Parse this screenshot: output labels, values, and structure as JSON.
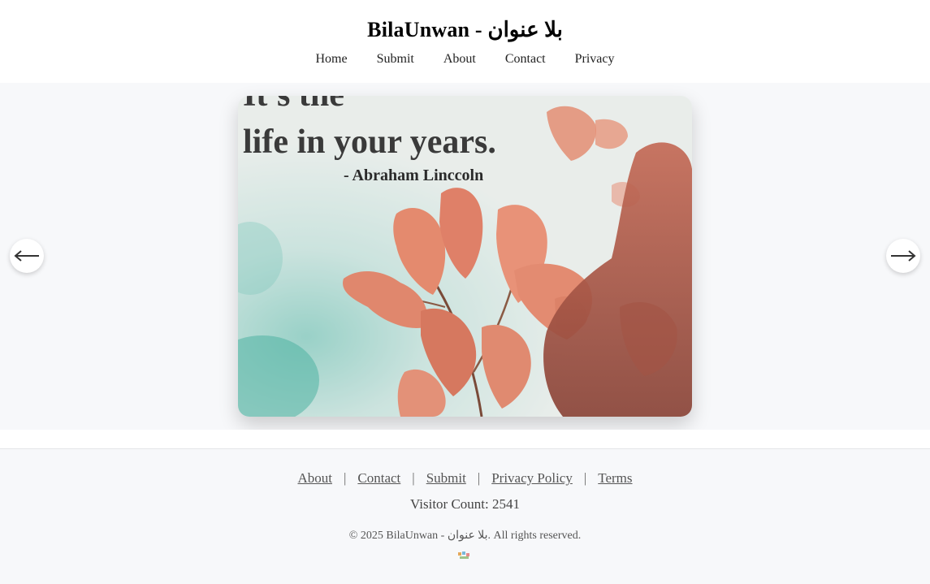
{
  "header": {
    "title": "BilaUnwan - بلا عنوان"
  },
  "nav": {
    "items": [
      "Home",
      "Submit",
      "About",
      "Contact",
      "Privacy"
    ]
  },
  "carousel": {
    "slide": {
      "quote_line_partial": "It's the",
      "quote_line": "life in your years.",
      "attribution": "- Abraham Linccoln"
    },
    "prev_icon": "arrow-left-icon",
    "next_icon": "arrow-right-icon"
  },
  "footer": {
    "links": [
      "About",
      "Contact",
      "Submit",
      "Privacy Policy",
      "Terms"
    ],
    "separator": "|",
    "visitor_count": "Visitor Count: 2541",
    "copyright": "© 2025 BilaUnwan - بلا عنوان. All rights reserved."
  },
  "colors": {
    "page_background": "#f7f8fa",
    "header_background": "#ffffff",
    "leaf": "#d9826a",
    "quote_text": "#3a3a3a"
  }
}
